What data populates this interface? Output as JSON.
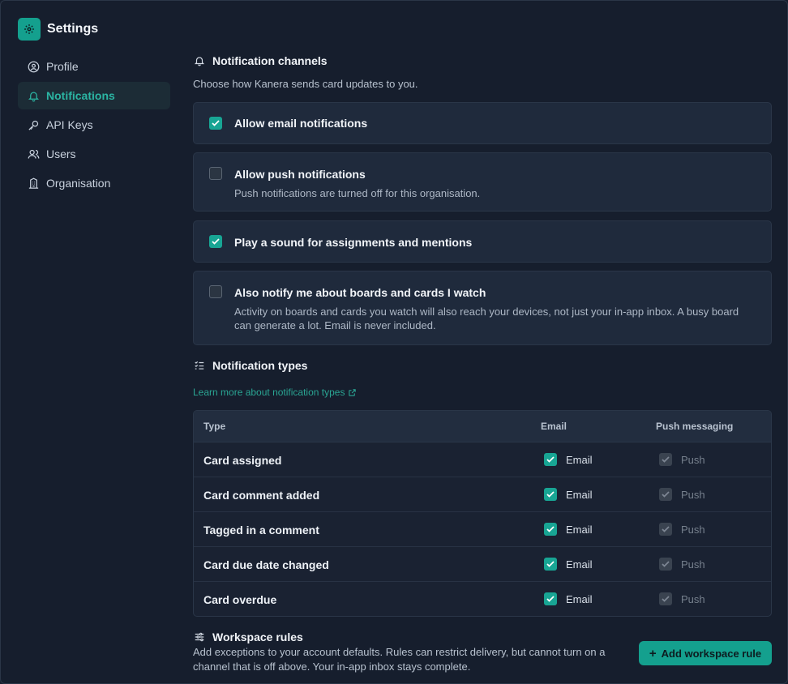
{
  "app": {
    "title": "Settings",
    "accent": "#14a08e"
  },
  "sidebar": {
    "items": [
      {
        "label": "Profile",
        "icon": "user-circle-icon",
        "active": false
      },
      {
        "label": "Notifications",
        "icon": "bell-icon",
        "active": true
      },
      {
        "label": "API Keys",
        "icon": "key-icon",
        "active": false
      },
      {
        "label": "Users",
        "icon": "users-icon",
        "active": false
      },
      {
        "label": "Organisation",
        "icon": "building-icon",
        "active": false
      }
    ]
  },
  "channels": {
    "title": "Notification channels",
    "description": "Choose how Kanera sends card updates to you.",
    "options": [
      {
        "label": "Allow email notifications",
        "checked": true
      },
      {
        "label": "Allow push notifications",
        "checked": false,
        "sub": "Push notifications are turned off for this organisation."
      },
      {
        "label": "Play a sound for assignments and mentions",
        "checked": true
      },
      {
        "label": "Also notify me about boards and cards I watch",
        "checked": false,
        "sub": "Activity on boards and cards you watch will also reach your devices, not just your in-app inbox. A busy board can generate a lot. Email is never included."
      }
    ]
  },
  "types": {
    "title": "Notification types",
    "link": "Learn more about notification types",
    "columns": {
      "type": "Type",
      "email": "Email",
      "push": "Push messaging"
    },
    "rows": [
      {
        "name": "Card assigned",
        "email": "Email",
        "push": "Push"
      },
      {
        "name": "Card comment added",
        "email": "Email",
        "push": "Push"
      },
      {
        "name": "Tagged in a comment",
        "email": "Email",
        "push": "Push"
      },
      {
        "name": "Card due date changed",
        "email": "Email",
        "push": "Push"
      },
      {
        "name": "Card overdue",
        "email": "Email",
        "push": "Push"
      }
    ]
  },
  "rules": {
    "title": "Workspace rules",
    "description": "Add exceptions to your account defaults. Rules can restrict delivery, but cannot turn on a channel that is off above. Your in-app inbox stays complete.",
    "button": "Add workspace rule"
  }
}
